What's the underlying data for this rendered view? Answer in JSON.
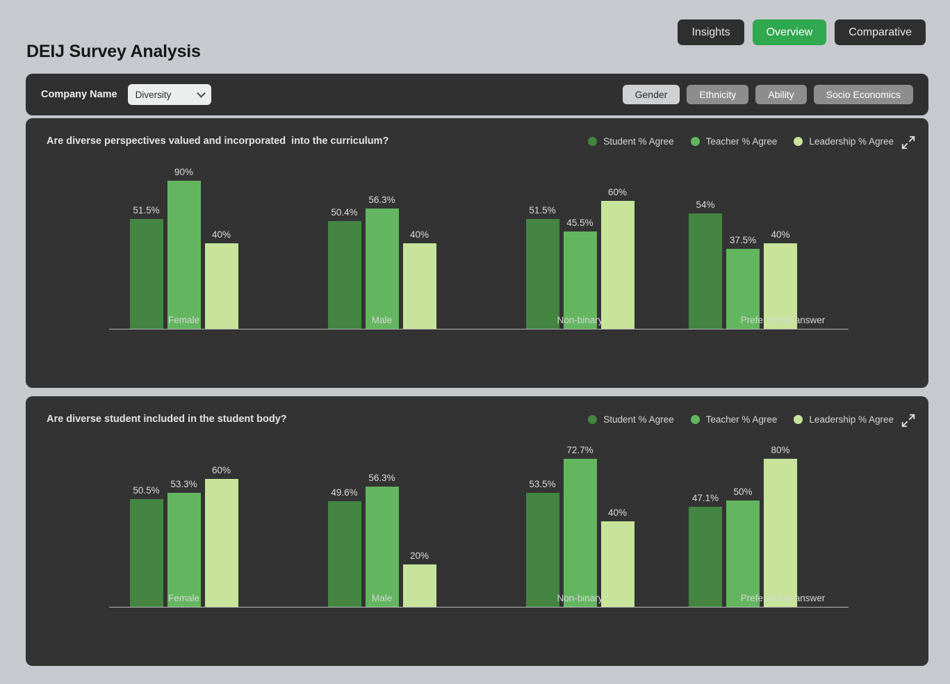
{
  "header": {
    "title": "DEIJ Survey Analysis",
    "nav": [
      {
        "label": "Insights",
        "active": false
      },
      {
        "label": "Overview",
        "active": true
      },
      {
        "label": "Comparative",
        "active": false
      }
    ]
  },
  "filters": {
    "company_label": "Company Name",
    "company_value": "Diversity",
    "company_icon": "chevron-down-icon",
    "categories": [
      {
        "label": "Gender",
        "selected": true
      },
      {
        "label": "Ethnicity",
        "selected": false
      },
      {
        "label": "Ability",
        "selected": false
      },
      {
        "label": "Socio Economics",
        "selected": false
      }
    ]
  },
  "colors": {
    "page_background": "#c6c9cd",
    "card_background": "#333333",
    "accent_green": "#2fa84f",
    "series_student": "#438541",
    "series_teacher": "#63b65f",
    "series_leadership": "#c8e49a"
  },
  "expand_icon": "expand-arrows-icon",
  "legend": [
    {
      "label": "Student % Agree",
      "color": "#438541"
    },
    {
      "label": "Teacher % Agree",
      "color": "#63b65f"
    },
    {
      "label": "Leadership % Agree",
      "color": "#c8e49a"
    }
  ],
  "chart_data": [
    {
      "type": "bar",
      "title": "Are diverse perspectives valued and incorporated  into the curriculum?",
      "xlabel": "",
      "ylabel": "",
      "ylim": [
        0,
        100
      ],
      "grid": false,
      "legend_position": "top-right",
      "categories": [
        "Female",
        "Male",
        "Non-binary",
        "Prefer not to answer"
      ],
      "series": [
        {
          "name": "Student % Agree",
          "color": "#438541",
          "values": [
            51.5,
            50.4,
            51.5,
            54
          ],
          "labels": [
            "51.5%",
            "50.4%",
            "51.5%",
            "54%"
          ]
        },
        {
          "name": "Teacher % Agree",
          "color": "#63b65f",
          "values": [
            90,
            56.3,
            45.5,
            37.5
          ],
          "labels": [
            "90%",
            "56.3%",
            "45.5%",
            "37.5%"
          ]
        },
        {
          "name": "Leadership % Agree",
          "color": "#c8e49a",
          "values": [
            40,
            40,
            60,
            40
          ],
          "labels": [
            "40%",
            "40%",
            "60%",
            "40%"
          ]
        }
      ]
    },
    {
      "type": "bar",
      "title": "Are diverse student included in the student body?",
      "xlabel": "",
      "ylabel": "",
      "ylim": [
        0,
        100
      ],
      "grid": false,
      "legend_position": "top-right",
      "categories": [
        "Female",
        "Male",
        "Non-binary",
        "Prefer not to answer"
      ],
      "series": [
        {
          "name": "Student % Agree",
          "color": "#438541",
          "values": [
            50.5,
            49.6,
            53.5,
            47.1
          ],
          "labels": [
            "50.5%",
            "49.6%",
            "53.5%",
            "47.1%"
          ]
        },
        {
          "name": "Teacher % Agree",
          "color": "#63b65f",
          "values": [
            53.3,
            56.3,
            72.7,
            50
          ],
          "labels": [
            "53.3%",
            "56.3%",
            "72.7%",
            "50%"
          ]
        },
        {
          "name": "Leadership % Agree",
          "color": "#c8e49a",
          "values": [
            60,
            20,
            40,
            80
          ],
          "labels": [
            "60%",
            "20%",
            "40%",
            "80%"
          ]
        }
      ]
    }
  ]
}
